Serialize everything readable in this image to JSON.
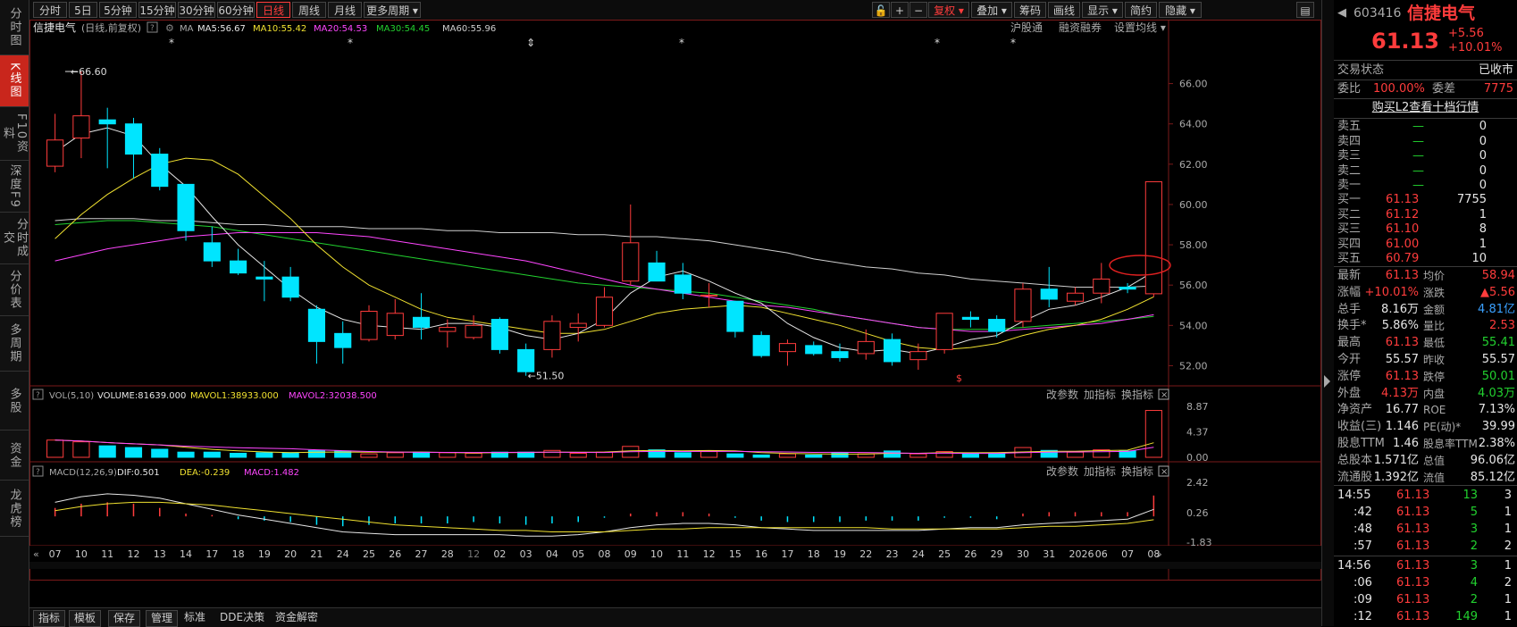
{
  "left_nav": [
    {
      "label": "分时图",
      "active": false
    },
    {
      "label": "K线图",
      "active": true
    },
    {
      "label": "F10资料",
      "active": false
    },
    {
      "label": "深度F9",
      "active": false
    },
    {
      "label": "分时成交",
      "active": false
    },
    {
      "label": "分价表",
      "active": false
    },
    {
      "label": "多周期",
      "active": false
    },
    {
      "label": "多股",
      "active": false
    },
    {
      "label": "资金",
      "active": false
    },
    {
      "label": "龙虎榜",
      "active": false
    }
  ],
  "toolbar": {
    "periods": [
      "分时",
      "5日",
      "5分钟",
      "15分钟",
      "30分钟",
      "60分钟",
      "日线",
      "周线",
      "月线",
      "更多周期 ▾"
    ],
    "active_period": "日线",
    "right": [
      "复权 ▾",
      "叠加 ▾",
      "筹码",
      "画线",
      "显示 ▾",
      "简约",
      "隐藏 ▾"
    ]
  },
  "chart_header": {
    "name": "信捷电气",
    "mode": "(日线,前复权)",
    "ma_label": "MA",
    "ma5": "MA5:56.67",
    "ma10": "MA10:55.42",
    "ma20": "MA20:54.53",
    "ma30": "MA30:54.45",
    "ma60": "MA60:55.96",
    "links": [
      "沪股通",
      "融资融券",
      "设置均线 ▾"
    ]
  },
  "vol_header": {
    "title": "VOL(5,10)",
    "volume": "VOLUME:81639.000",
    "mavol1": "MAVOL1:38933.000",
    "mavol2": "MAVOL2:32038.500",
    "links": [
      "改参数",
      "加指标",
      "换指标"
    ]
  },
  "macd_header": {
    "title": "MACD(12,26,9)",
    "dif": "DIF:0.501",
    "dea": "DEA:-0.239",
    "macd": "MACD:1.482",
    "links": [
      "改参数",
      "加指标",
      "换指标"
    ]
  },
  "bottom_bar": [
    "指标",
    "模板",
    "保存",
    "管理",
    "标准",
    "DDE决策",
    "资金解密"
  ],
  "quote": {
    "code": "603416",
    "name": "信捷电气",
    "price": "61.13",
    "change": "+5.56",
    "change_pct": "+10.01%",
    "status_label": "交易状态",
    "status_value": "已收市",
    "weibi_label": "委比",
    "weibi_value": "100.00%",
    "weicha_label": "委差",
    "weicha_value": "7775",
    "l2_link": "购买L2查看十档行情",
    "sells": [
      {
        "label": "卖五",
        "price": "—",
        "vol": "0"
      },
      {
        "label": "卖四",
        "price": "—",
        "vol": "0"
      },
      {
        "label": "卖三",
        "price": "—",
        "vol": "0"
      },
      {
        "label": "卖二",
        "price": "—",
        "vol": "0"
      },
      {
        "label": "卖一",
        "price": "—",
        "vol": "0"
      }
    ],
    "buys": [
      {
        "label": "买一",
        "price": "61.13",
        "vol": "7755"
      },
      {
        "label": "买二",
        "price": "61.12",
        "vol": "1"
      },
      {
        "label": "买三",
        "price": "61.10",
        "vol": "8"
      },
      {
        "label": "买四",
        "price": "61.00",
        "vol": "1"
      },
      {
        "label": "买五",
        "price": "60.79",
        "vol": "10"
      }
    ],
    "stats": [
      {
        "l1": "最新",
        "v1": "61.13",
        "c1": "red",
        "l2": "均价",
        "v2": "58.94",
        "c2": "red"
      },
      {
        "l1": "涨幅",
        "v1": "+10.01%",
        "c1": "red",
        "l2": "涨跌",
        "v2": "▲5.56",
        "c2": "red"
      },
      {
        "l1": "总手",
        "v1": "8.16万",
        "c1": "white",
        "l2": "金额",
        "v2": "4.81亿",
        "c2": "blue"
      },
      {
        "l1": "换手*",
        "v1": "5.86%",
        "c1": "white",
        "l2": "量比",
        "v2": "2.53",
        "c2": "red"
      },
      {
        "l1": "最高",
        "v1": "61.13",
        "c1": "red",
        "l2": "最低",
        "v2": "55.41",
        "c2": "green"
      },
      {
        "l1": "今开",
        "v1": "55.57",
        "c1": "white",
        "l2": "昨收",
        "v2": "55.57",
        "c2": "white"
      },
      {
        "l1": "涨停",
        "v1": "61.13",
        "c1": "red",
        "l2": "跌停",
        "v2": "50.01",
        "c2": "green"
      },
      {
        "l1": "外盘",
        "v1": "4.13万",
        "c1": "red",
        "l2": "内盘",
        "v2": "4.03万",
        "c2": "green"
      },
      {
        "l1": "净资产",
        "v1": "16.77",
        "c1": "white",
        "l2": "ROE",
        "v2": "7.13%",
        "c2": "white"
      },
      {
        "l1": "收益(三)",
        "v1": "1.146",
        "c1": "white",
        "l2": "PE(动)*",
        "v2": "39.99",
        "c2": "white"
      },
      {
        "l1": "股息TTM",
        "v1": "1.46",
        "c1": "white",
        "l2": "股息率TTM",
        "v2": "2.38%",
        "c2": "white"
      },
      {
        "l1": "总股本",
        "v1": "1.571亿",
        "c1": "white",
        "l2": "总值",
        "v2": "96.06亿",
        "c2": "white"
      },
      {
        "l1": "流通股",
        "v1": "1.392亿",
        "c1": "white",
        "l2": "流值",
        "v2": "85.12亿",
        "c2": "white"
      }
    ],
    "ticks": [
      {
        "time": "14:55",
        "price": "61.13",
        "vol": "13",
        "n": "3",
        "vc": "green"
      },
      {
        "time": ":42",
        "price": "61.13",
        "vol": "5",
        "n": "1",
        "vc": "green"
      },
      {
        "time": ":48",
        "price": "61.13",
        "vol": "3",
        "n": "1",
        "vc": "green"
      },
      {
        "time": ":57",
        "price": "61.13",
        "vol": "2",
        "n": "2",
        "vc": "green"
      },
      {
        "time": "14:56",
        "price": "61.13",
        "vol": "3",
        "n": "1",
        "vc": "green"
      },
      {
        "time": ":06",
        "price": "61.13",
        "vol": "4",
        "n": "2",
        "vc": "green"
      },
      {
        "time": ":09",
        "price": "61.13",
        "vol": "2",
        "n": "1",
        "vc": "green"
      },
      {
        "time": ":12",
        "price": "61.13",
        "vol": "149",
        "n": "1",
        "vc": "green"
      }
    ]
  },
  "chart_data": {
    "type": "candlestick",
    "dates": [
      "07",
      "10",
      "11",
      "12",
      "13",
      "14",
      "17",
      "18",
      "19",
      "20",
      "21",
      "24",
      "25",
      "26",
      "27",
      "28",
      "12",
      "02",
      "03",
      "04",
      "05",
      "08",
      "09",
      "10",
      "11",
      "12",
      "15",
      "16",
      "17",
      "18",
      "19",
      "22",
      "23",
      "24",
      "25",
      "26",
      "29",
      "30",
      "31",
      "2026",
      "06",
      "07",
      "08"
    ],
    "ohlc": [
      [
        61.9,
        63.2,
        61.6,
        64.5
      ],
      [
        63.3,
        64.4,
        62.3,
        66.6
      ],
      [
        64.2,
        64.0,
        61.8,
        64.8
      ],
      [
        64.0,
        62.5,
        61.3,
        64.3
      ],
      [
        62.5,
        60.9,
        60.7,
        62.8
      ],
      [
        61.0,
        58.7,
        58.2,
        61.0
      ],
      [
        58.1,
        57.2,
        56.9,
        58.9
      ],
      [
        57.2,
        56.6,
        56.5,
        57.8
      ],
      [
        56.4,
        56.3,
        55.2,
        57.2
      ],
      [
        56.4,
        55.4,
        55.2,
        56.9
      ],
      [
        54.8,
        53.2,
        52.1,
        55.0
      ],
      [
        53.6,
        52.9,
        52.1,
        54.2
      ],
      [
        53.3,
        54.7,
        53.2,
        55.0
      ],
      [
        53.5,
        54.6,
        53.3,
        55.3
      ],
      [
        54.4,
        53.9,
        53.3,
        55.6
      ],
      [
        53.7,
        53.9,
        52.9,
        54.3
      ],
      [
        53.4,
        54.0,
        53.3,
        54.5
      ],
      [
        54.3,
        52.8,
        52.6,
        54.4
      ],
      [
        52.8,
        51.7,
        51.5,
        53.1
      ],
      [
        52.8,
        54.2,
        52.4,
        54.5
      ],
      [
        53.9,
        54.1,
        53.2,
        54.6
      ],
      [
        54.0,
        55.4,
        53.9,
        55.9
      ],
      [
        56.2,
        58.1,
        56.0,
        60.0
      ],
      [
        57.1,
        56.2,
        56.2,
        57.7
      ],
      [
        56.5,
        55.6,
        55.3,
        57.1
      ],
      [
        55.5,
        55.5,
        54.9,
        56.1
      ],
      [
        55.2,
        53.7,
        53.4,
        55.2
      ],
      [
        53.5,
        52.5,
        52.4,
        53.7
      ],
      [
        52.7,
        53.1,
        52.0,
        53.3
      ],
      [
        53.0,
        52.6,
        52.5,
        53.2
      ],
      [
        52.7,
        52.4,
        52.2,
        53.1
      ],
      [
        52.6,
        53.2,
        52.3,
        53.8
      ],
      [
        53.3,
        52.2,
        52.0,
        53.6
      ],
      [
        52.3,
        52.7,
        51.8,
        53.1
      ],
      [
        52.8,
        54.6,
        52.6,
        54.6
      ],
      [
        54.4,
        54.3,
        53.9,
        54.7
      ],
      [
        54.3,
        53.7,
        53.4,
        54.5
      ],
      [
        54.2,
        55.8,
        53.9,
        56.1
      ],
      [
        55.8,
        55.3,
        54.9,
        56.9
      ],
      [
        55.2,
        55.6,
        55.0,
        55.9
      ],
      [
        55.6,
        56.3,
        55.1,
        57.1
      ],
      [
        55.9,
        55.8,
        55.6,
        56.1
      ],
      [
        55.57,
        61.13,
        55.41,
        61.13
      ]
    ],
    "ma5": [
      62.6,
      63.5,
      63.8,
      63.4,
      62.0,
      60.9,
      59.4,
      58.0,
      56.9,
      55.8,
      54.9,
      54.3,
      54.0,
      53.9,
      53.8,
      54.1,
      54.1,
      53.9,
      53.5,
      53.3,
      53.6,
      54.3,
      55.6,
      56.4,
      56.7,
      56.2,
      55.6,
      55.1,
      54.1,
      53.4,
      52.9,
      52.7,
      52.8,
      52.6,
      52.9,
      53.3,
      53.5,
      54.2,
      54.8,
      55.0,
      55.4,
      55.9,
      56.67
    ],
    "ma10": [
      58.3,
      59.5,
      60.5,
      61.3,
      62.0,
      62.3,
      62.2,
      61.5,
      60.4,
      59.3,
      58.0,
      56.9,
      56.0,
      55.4,
      54.8,
      54.4,
      54.2,
      54.0,
      53.8,
      53.6,
      53.6,
      53.8,
      54.2,
      54.6,
      54.8,
      54.9,
      55.0,
      54.9,
      54.6,
      54.3,
      54.0,
      53.6,
      53.2,
      52.9,
      52.8,
      52.9,
      53.1,
      53.5,
      53.8,
      54.0,
      54.3,
      54.8,
      55.42
    ],
    "ma20": [
      57.2,
      57.5,
      57.8,
      58.0,
      58.2,
      58.4,
      58.5,
      58.6,
      58.6,
      58.6,
      58.6,
      58.5,
      58.4,
      58.2,
      58.0,
      57.8,
      57.6,
      57.4,
      57.2,
      56.9,
      56.6,
      56.3,
      56.0,
      55.8,
      55.6,
      55.4,
      55.2,
      55.0,
      54.9,
      54.7,
      54.5,
      54.3,
      54.1,
      53.9,
      53.8,
      53.7,
      53.7,
      53.8,
      53.9,
      54.0,
      54.1,
      54.3,
      54.53
    ],
    "ma30": [
      59.0,
      59.1,
      59.2,
      59.2,
      59.1,
      59.0,
      58.9,
      58.7,
      58.5,
      58.3,
      58.1,
      57.9,
      57.7,
      57.5,
      57.3,
      57.1,
      56.9,
      56.7,
      56.5,
      56.3,
      56.1,
      56.0,
      55.9,
      55.8,
      55.7,
      55.6,
      55.4,
      55.2,
      55.0,
      54.8,
      54.5,
      54.3,
      54.1,
      53.9,
      53.8,
      53.8,
      53.8,
      53.9,
      54.0,
      54.1,
      54.2,
      54.3,
      54.45
    ],
    "ma60": [
      59.2,
      59.3,
      59.3,
      59.3,
      59.2,
      59.2,
      59.1,
      59.0,
      59.0,
      58.9,
      58.9,
      58.9,
      58.8,
      58.8,
      58.8,
      58.7,
      58.7,
      58.6,
      58.6,
      58.6,
      58.5,
      58.5,
      58.4,
      58.4,
      58.3,
      58.2,
      58.0,
      57.8,
      57.6,
      57.3,
      57.1,
      56.9,
      56.8,
      56.6,
      56.5,
      56.3,
      56.2,
      56.1,
      56.0,
      55.9,
      55.9,
      55.9,
      55.96
    ],
    "y_ticks": [
      "66.00",
      "64.00",
      "62.00",
      "60.00",
      "58.00",
      "56.00",
      "54.00",
      "52.00"
    ],
    "ylim": [
      51.0,
      67.4
    ],
    "high_label": "66.60",
    "low_label": "51.50",
    "volume": [
      30000,
      27000,
      20000,
      17000,
      14000,
      9000,
      9000,
      7000,
      8000,
      8000,
      12000,
      11000,
      6000,
      8000,
      9000,
      8000,
      7000,
      9000,
      9000,
      12000,
      7000,
      9000,
      19000,
      13000,
      8000,
      10000,
      6000,
      4000,
      6000,
      4000,
      8000,
      6000,
      11000,
      6000,
      10000,
      7000,
      7000,
      17000,
      12000,
      9000,
      13000,
      11000,
      81639
    ],
    "vol_ticks": [
      "8.87",
      "4.37",
      "0.00"
    ],
    "macd_bars": [
      0.6,
      0.9,
      1.0,
      0.9,
      0.6,
      0.2,
      0.1,
      -0.2,
      -0.3,
      -0.4,
      -0.6,
      -0.7,
      -0.6,
      -0.5,
      -0.5,
      -0.5,
      -0.4,
      -0.5,
      -0.6,
      -0.5,
      -0.4,
      -0.1,
      0.2,
      0.3,
      0.3,
      0.2,
      -0.1,
      -0.3,
      -0.4,
      -0.4,
      -0.4,
      -0.3,
      -0.3,
      -0.3,
      -0.1,
      -0.1,
      -0.2,
      0.2,
      0.3,
      0.3,
      0.3,
      0.3,
      1.482
    ],
    "dif": [
      1.0,
      1.4,
      1.6,
      1.5,
      1.3,
      0.9,
      0.5,
      0.1,
      -0.2,
      -0.5,
      -0.8,
      -1.1,
      -1.2,
      -1.3,
      -1.3,
      -1.3,
      -1.3,
      -1.3,
      -1.4,
      -1.4,
      -1.3,
      -1.1,
      -0.8,
      -0.6,
      -0.5,
      -0.5,
      -0.6,
      -0.8,
      -0.9,
      -1.0,
      -1.0,
      -1.0,
      -1.0,
      -1.0,
      -0.9,
      -0.8,
      -0.8,
      -0.6,
      -0.5,
      -0.4,
      -0.3,
      -0.2,
      0.501
    ],
    "dea": [
      0.4,
      0.7,
      0.9,
      1.0,
      1.0,
      0.9,
      0.8,
      0.6,
      0.4,
      0.2,
      0.0,
      -0.2,
      -0.4,
      -0.6,
      -0.7,
      -0.8,
      -0.9,
      -1.0,
      -1.0,
      -1.1,
      -1.1,
      -1.1,
      -1.0,
      -0.9,
      -0.9,
      -0.8,
      -0.8,
      -0.8,
      -0.8,
      -0.8,
      -0.8,
      -0.8,
      -0.9,
      -0.9,
      -0.9,
      -0.9,
      -0.9,
      -0.8,
      -0.7,
      -0.7,
      -0.6,
      -0.5,
      -0.239
    ],
    "macd_ticks": [
      "2.42",
      "0.26",
      "-1.83"
    ]
  }
}
